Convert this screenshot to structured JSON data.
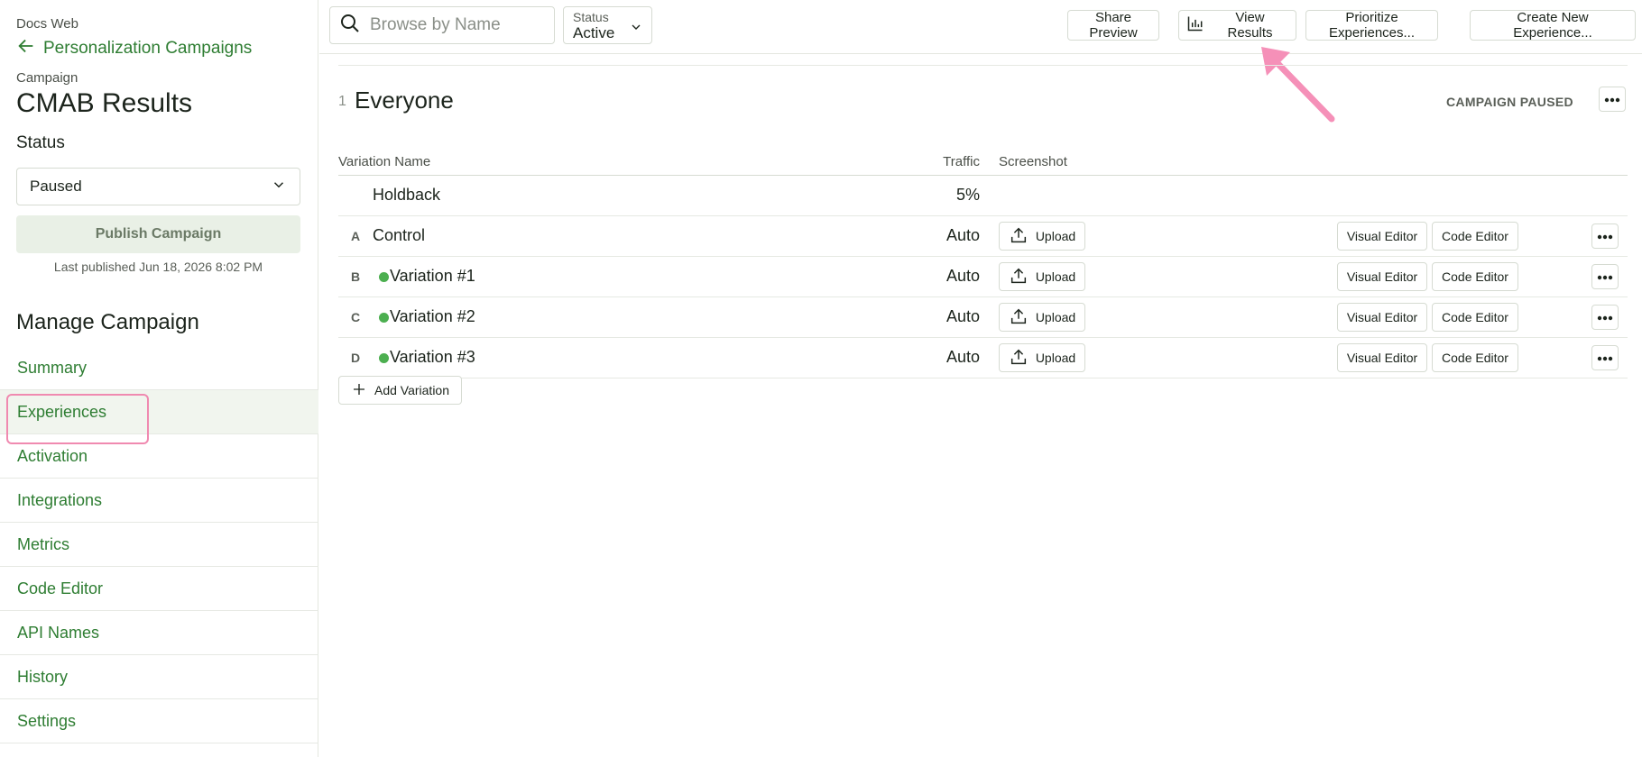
{
  "sidebar": {
    "project": "Docs Web",
    "back_label": "Personalization Campaigns",
    "campaign_label": "Campaign",
    "campaign_title": "CMAB Results",
    "status_label": "Status",
    "status_value": "Paused",
    "publish_label": "Publish Campaign",
    "last_published": "Last published Jun 18, 2026 8:02 PM",
    "manage_title": "Manage Campaign",
    "nav": [
      {
        "label": "Summary",
        "active": false
      },
      {
        "label": "Experiences",
        "active": true
      },
      {
        "label": "Activation",
        "active": false
      },
      {
        "label": "Integrations",
        "active": false
      },
      {
        "label": "Metrics",
        "active": false
      },
      {
        "label": "Code Editor",
        "active": false
      },
      {
        "label": "API Names",
        "active": false
      },
      {
        "label": "History",
        "active": false
      },
      {
        "label": "Settings",
        "active": false
      }
    ]
  },
  "topbar": {
    "search_placeholder": "Browse by Name",
    "status_filter_label": "Status",
    "status_filter_value": "Active",
    "share_preview": "Share Preview",
    "view_results": "View Results",
    "prioritize": "Prioritize Experiences...",
    "create_new": "Create New Experience..."
  },
  "audience": {
    "number": "1",
    "name": "Everyone",
    "state": "CAMPAIGN PAUSED"
  },
  "table": {
    "headers": {
      "name": "Variation Name",
      "traffic": "Traffic",
      "screenshot": "Screenshot"
    },
    "rows": [
      {
        "letter": "",
        "name": "Holdback",
        "traffic": "5%",
        "has_dot": false,
        "has_actions": false
      },
      {
        "letter": "A",
        "name": "Control",
        "traffic": "Auto",
        "has_dot": false,
        "has_actions": true
      },
      {
        "letter": "B",
        "name": "Variation #1",
        "traffic": "Auto",
        "has_dot": true,
        "has_actions": true
      },
      {
        "letter": "C",
        "name": "Variation #2",
        "traffic": "Auto",
        "has_dot": true,
        "has_actions": true
      },
      {
        "letter": "D",
        "name": "Variation #3",
        "traffic": "Auto",
        "has_dot": true,
        "has_actions": true
      }
    ],
    "upload_label": "Upload",
    "visual_editor_label": "Visual Editor",
    "code_editor_label": "Code Editor",
    "add_variation_label": "Add Variation"
  },
  "colors": {
    "accent_green": "#2e7d32",
    "dot_green": "#4caf50",
    "highlight_pink": "#f08ab0"
  },
  "icons": {
    "back": "arrow-left-icon",
    "status_dropdown": "chevron-down-icon",
    "search": "search-icon",
    "view_results": "bar-chart-icon",
    "upload": "upload-icon",
    "more": "more-horizontal-icon",
    "add": "plus-icon"
  }
}
